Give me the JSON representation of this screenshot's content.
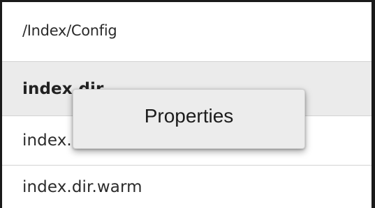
{
  "path_bar": {
    "path": "/Index/Config"
  },
  "table": {
    "header_row": "index.dir",
    "rows": [
      "index.dir.hot",
      "index.dir.warm"
    ]
  },
  "context_menu": {
    "items": [
      {
        "label": "Properties"
      }
    ]
  }
}
